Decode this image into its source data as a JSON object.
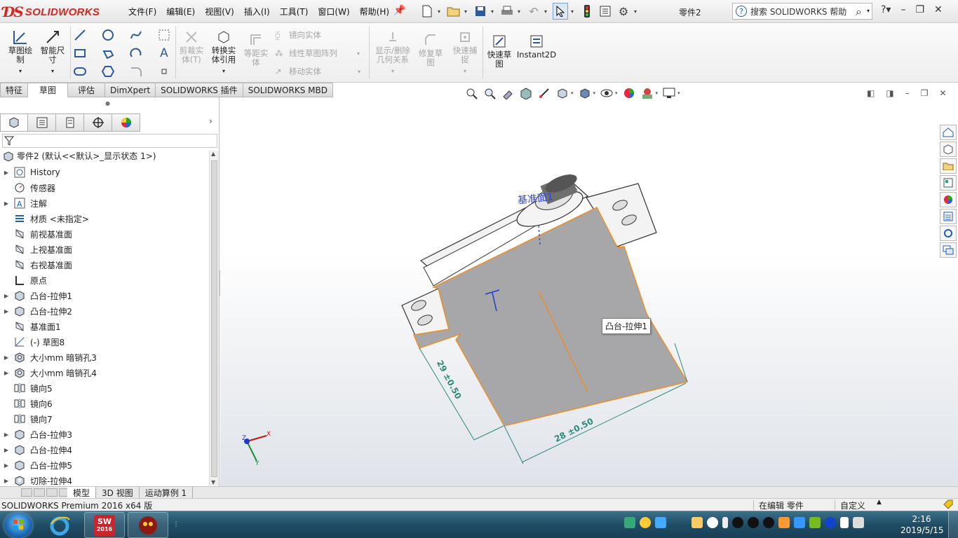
{
  "app": {
    "logo_brand": "SOLIDWORKS",
    "document_name": "零件2"
  },
  "menu": [
    "文件(F)",
    "编辑(E)",
    "视图(V)",
    "插入(I)",
    "工具(T)",
    "窗口(W)",
    "帮助(H)"
  ],
  "search": {
    "placeholder": "搜索 SOLIDWORKS 帮助"
  },
  "ribbon": {
    "sketch": "草图绘\n制",
    "smart_dim": "智能尺\n寸",
    "trim": "剪裁实\n体(T)",
    "convert": "转换实\n体引用",
    "offset": "等距实\n体",
    "mirror": "镜向实体",
    "linear_pattern": "线性草图阵列",
    "move": "移动实体",
    "display_rel": "显示/删除\n几何关系",
    "repair": "修复草\n图",
    "quick_snap": "快速捕\n捉",
    "rapid_sketch": "快速草\n图",
    "instant2d": "Instant2D"
  },
  "command_tabs": [
    "特征",
    "草图",
    "评估",
    "DimXpert",
    "SOLIDWORKS 插件",
    "SOLIDWORKS MBD"
  ],
  "command_tab_active": "草图",
  "tree": {
    "root": "零件2  (默认<<默认>_显示状态 1>)",
    "items": [
      {
        "label": "History",
        "icon": "history-icon",
        "expand": true
      },
      {
        "label": "传感器",
        "icon": "sensor-icon",
        "expand": false
      },
      {
        "label": "注解",
        "icon": "annotation-icon",
        "expand": true
      },
      {
        "label": "材质 <未指定>",
        "icon": "material-icon",
        "expand": false
      },
      {
        "label": "前视基准面",
        "icon": "plane-icon",
        "expand": false
      },
      {
        "label": "上视基准面",
        "icon": "plane-icon",
        "expand": false
      },
      {
        "label": "右视基准面",
        "icon": "plane-icon",
        "expand": false
      },
      {
        "label": "原点",
        "icon": "origin-icon",
        "expand": false
      },
      {
        "label": "凸台-拉伸1",
        "icon": "extrude-icon",
        "expand": true
      },
      {
        "label": "凸台-拉伸2",
        "icon": "extrude-icon",
        "expand": true
      },
      {
        "label": "基准面1",
        "icon": "plane-icon",
        "expand": false
      },
      {
        "label": "(-) 草图8",
        "icon": "sketch-icon",
        "expand": false
      },
      {
        "label": "大小mm 暗销孔3",
        "icon": "hole-icon",
        "expand": true
      },
      {
        "label": "大小mm 暗销孔4",
        "icon": "hole-icon",
        "expand": true
      },
      {
        "label": "镜向5",
        "icon": "mirror-icon",
        "expand": false
      },
      {
        "label": "镜向6",
        "icon": "mirror-icon",
        "expand": false
      },
      {
        "label": "镜向7",
        "icon": "mirror-icon",
        "expand": false
      },
      {
        "label": "凸台-拉伸3",
        "icon": "extrude-icon",
        "expand": true
      },
      {
        "label": "凸台-拉伸4",
        "icon": "extrude-icon",
        "expand": true
      },
      {
        "label": "凸台-拉伸5",
        "icon": "extrude-icon",
        "expand": true
      },
      {
        "label": "切除-拉伸4",
        "icon": "cut-icon",
        "expand": true
      }
    ]
  },
  "graphics": {
    "tooltip": "凸台-拉伸1",
    "plane_label": "基准面1",
    "dim_width": "28 ±0.50",
    "dim_height": "29 ±0.50",
    "triad_x": "X",
    "triad_y": "Y",
    "triad_z": "Z"
  },
  "bottom_tabs": [
    "模型",
    "3D 视图",
    "运动算例 1"
  ],
  "status": {
    "left": "SOLIDWORKS Premium 2016 x64 版",
    "editing": "在编辑 零件",
    "custom": "自定义"
  },
  "taskbar": {
    "sw_label": "2016",
    "time": "2:16",
    "date": "2019/5/15"
  },
  "colors": {
    "accent": "#d4261e",
    "part_face": "#a7a7aa",
    "edge_highlight": "#f08c1e",
    "dimension": "#2c8a7a"
  }
}
